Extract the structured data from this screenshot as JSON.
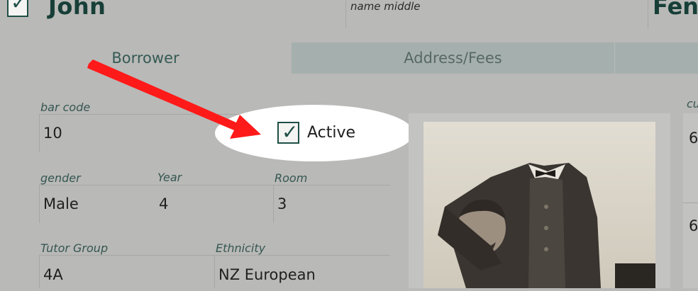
{
  "header": {
    "first_name": "John",
    "middle_name_label": "name middle",
    "last_name": "Fen"
  },
  "tabs": [
    {
      "label": "Borrower"
    },
    {
      "label": "Address/Fees"
    }
  ],
  "fields": {
    "bar_code": {
      "label": "bar code",
      "value": "10"
    },
    "active": {
      "label": "Active",
      "checked": true
    },
    "gender": {
      "label": "gender",
      "value": "Male"
    },
    "year": {
      "label": "Year",
      "value": "4"
    },
    "room": {
      "label": "Room",
      "value": "3"
    },
    "tutor_group": {
      "label": "Tutor Group",
      "value": "4A"
    },
    "ethnicity": {
      "label": "Ethnicity",
      "value": "NZ European"
    }
  },
  "right_panel": {
    "label_fragment": "cu",
    "values": [
      "6",
      "6"
    ]
  },
  "colors": {
    "accent": "#1f4f46",
    "arrow": "#ff1a1a",
    "tab_inactive": "#a5b0ae"
  }
}
